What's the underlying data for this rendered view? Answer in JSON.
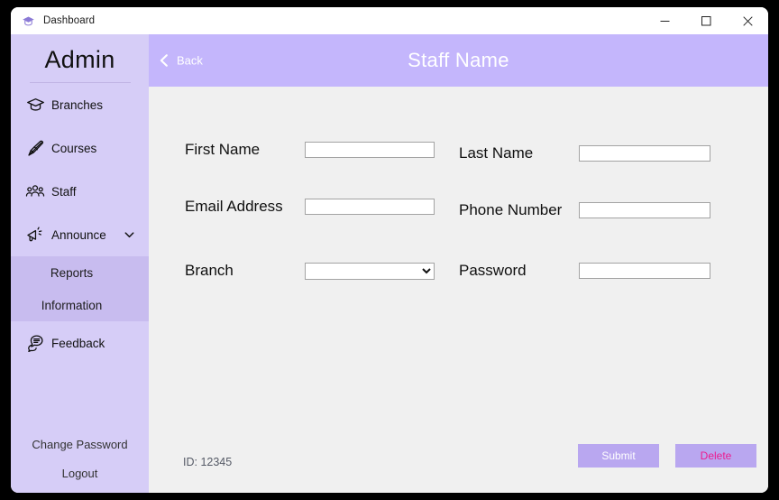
{
  "window": {
    "title": "Dashboard",
    "title_icon": "graduation-cap-icon",
    "minimize": "─",
    "maximize": "□",
    "close": "✕"
  },
  "sidebar": {
    "heading": "Admin",
    "items": [
      {
        "label": "Branches",
        "icon": "graduation-cap-icon"
      },
      {
        "label": "Courses",
        "icon": "diploma-scroll-icon"
      },
      {
        "label": "Staff",
        "icon": "people-group-icon"
      },
      {
        "label": "Announce",
        "icon": "megaphone-icon",
        "expandable": true,
        "expanded": true
      }
    ],
    "submenu": [
      {
        "label": "Reports"
      },
      {
        "label": "Information"
      }
    ],
    "feedback": {
      "label": "Feedback",
      "icon": "speech-bubble-lines-icon"
    },
    "bottom": [
      {
        "label": "Change Password"
      },
      {
        "label": "Logout"
      }
    ]
  },
  "header": {
    "back_label": "Back",
    "back_icon": "chevron-left-icon",
    "title": "Staff Name"
  },
  "form": {
    "fields": [
      {
        "label": "First Name",
        "value": "",
        "placeholder": "",
        "type": "text"
      },
      {
        "label": "Last Name",
        "value": "",
        "placeholder": "",
        "type": "text"
      },
      {
        "label": "Email Address",
        "value": "",
        "placeholder": "",
        "type": "text"
      },
      {
        "label": "Phone Number",
        "value": "",
        "placeholder": "",
        "type": "text"
      },
      {
        "label": "Branch",
        "value": "",
        "placeholder": "",
        "type": "select",
        "options": [
          ""
        ]
      },
      {
        "label": "Password",
        "value": "",
        "placeholder": "",
        "type": "text"
      }
    ],
    "id_text": "ID: 12345",
    "submit_label": "Submit",
    "delete_label": "Delete"
  },
  "colors": {
    "sidebar_bg": "#d6cdf7",
    "submenu_bg": "#c8bcef",
    "header_bg": "#c4b6fc",
    "main_bg": "#f0f0f0",
    "button_bg": "#b9a7f0",
    "delete_text": "#ec1c8f",
    "submit_text": "#ffffff"
  }
}
